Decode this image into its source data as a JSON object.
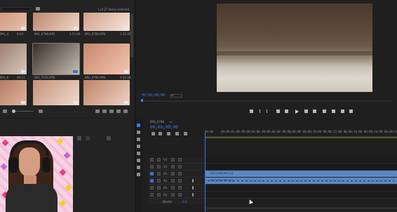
{
  "project": {
    "items_selected": "1 of 27 items selected",
    "thumbnails": [
      {
        "label": "IMG_4",
        "dur": "8:03",
        "colors": [
          "#c98d73",
          "#e6c1aa"
        ]
      },
      {
        "label": "IMG_6788.MP4",
        "dur": "1:51:04",
        "colors": [
          "#b9876d",
          "#f2d6c5"
        ]
      },
      {
        "label": "IMG_6789.MP4",
        "dur": "1:32:26",
        "colors": [
          "#d19f8a",
          "#f6e6dc"
        ]
      },
      {
        "label": "IMG_6",
        "dur": "49:12",
        "colors": [
          "#8d6c5a",
          "#d6cabd"
        ]
      },
      {
        "label": "IMG_7036.MP4",
        "dur": "",
        "colors": [
          "#3a2e26",
          "#c8c0b4"
        ],
        "selected": true,
        "badge": "blue"
      },
      {
        "label": "IMG_6790.MP4",
        "dur": "1:32:28",
        "colors": [
          "#c7866b",
          "#f3c7b2"
        ]
      },
      {
        "label": "",
        "dur": "",
        "colors": [
          "#a46a52",
          "#e1b49d"
        ]
      },
      {
        "label": "",
        "dur": "",
        "colors": [
          "#c49279",
          "#efdbcf"
        ]
      },
      {
        "label": "",
        "dur": "",
        "colors": [
          "#c08266",
          "#ecd3c4"
        ]
      }
    ]
  },
  "program": {
    "timecode": "00;00;00;00",
    "fit": "Fit"
  },
  "timeline": {
    "sequence_name": "IMG_6788",
    "timecode": "00;00;00;00",
    "ticks": [
      "00;00",
      "00;00;02;00",
      "00;00;04;00",
      "00;00;06;00",
      "00;00;08;00",
      "00;00;10;00",
      "00;00;12;00",
      "00;00;14;00",
      "00;00;16;00",
      "00;00;18;00"
    ],
    "tracks": [
      {
        "name": "V3"
      },
      {
        "name": "V2"
      },
      {
        "name": "V1",
        "clip": "IMG_6788.MP4 [V]"
      },
      {
        "name": "A1",
        "clip": "IMG_6788.MP4 [A]"
      },
      {
        "name": "A2"
      },
      {
        "name": "A3"
      }
    ],
    "master": "Master",
    "master_value": "0.0"
  }
}
